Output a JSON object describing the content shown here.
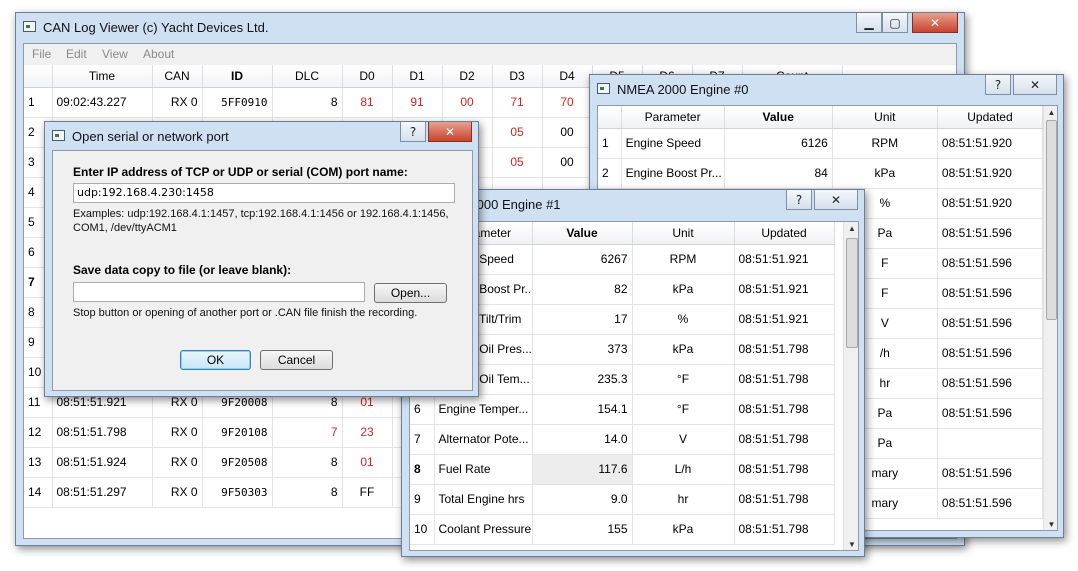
{
  "main": {
    "title": "CAN Log Viewer (c) Yacht Devices Ltd.",
    "menu": [
      "File",
      "Edit",
      "View",
      "About"
    ],
    "columns": [
      "Time",
      "CAN",
      "ID",
      "DLC",
      "D0",
      "D1",
      "D2",
      "D3",
      "D4",
      "D5",
      "D6",
      "D7",
      "Count"
    ],
    "rows": [
      {
        "n": "1",
        "time": "09:02:43.227",
        "can": "RX 0",
        "id": "5FF0910",
        "dlc": "8",
        "d": [
          "81",
          "91",
          "00",
          "71",
          "70"
        ],
        "red": [
          true,
          true,
          true,
          true,
          true
        ]
      },
      {
        "n": "2",
        "time": "",
        "can": "",
        "id": "",
        "dlc": "",
        "d": [
          "",
          "",
          "",
          "05",
          "00"
        ],
        "red": [
          false,
          false,
          false,
          true,
          false
        ]
      },
      {
        "n": "3",
        "time": "",
        "can": "",
        "id": "",
        "dlc": "",
        "d": [
          "",
          "",
          "",
          "05",
          "00"
        ],
        "red": [
          false,
          false,
          false,
          true,
          false
        ]
      },
      {
        "n": "4",
        "time": "",
        "can": "",
        "id": "",
        "dlc": "",
        "d": [
          "",
          "",
          "",
          "",
          ""
        ],
        "red": [
          false,
          false,
          false,
          false,
          false
        ]
      },
      {
        "n": "5",
        "time": "",
        "can": "",
        "id": "",
        "dlc": "",
        "d": [
          "",
          "",
          "",
          "",
          ""
        ],
        "red": [
          false,
          false,
          false,
          false,
          false
        ]
      },
      {
        "n": "6",
        "time": "",
        "can": "",
        "id": "",
        "dlc": "",
        "d": [
          "",
          "",
          "",
          "",
          ""
        ],
        "red": [
          false,
          false,
          false,
          false,
          false
        ]
      },
      {
        "n": "7",
        "time": "",
        "can": "",
        "id": "",
        "dlc": "",
        "d": [
          "",
          "",
          "",
          "",
          ""
        ],
        "red": [
          false,
          false,
          false,
          false,
          false
        ]
      },
      {
        "n": "8",
        "time": "",
        "can": "",
        "id": "",
        "dlc": "",
        "d": [
          "",
          "",
          "",
          "",
          ""
        ],
        "red": [
          false,
          false,
          false,
          false,
          false
        ]
      },
      {
        "n": "9",
        "time": "",
        "can": "",
        "id": "",
        "dlc": "",
        "d": [
          "",
          "",
          "",
          "",
          ""
        ],
        "red": [
          false,
          false,
          false,
          false,
          false
        ]
      },
      {
        "n": "10",
        "time": "",
        "can": "",
        "id": "",
        "dlc": "",
        "d": [
          "",
          "",
          "",
          "",
          ""
        ],
        "red": [
          false,
          false,
          false,
          false,
          false
        ]
      },
      {
        "n": "11",
        "time": "08:51:51.921",
        "can": "RX 0",
        "id": "9F20008",
        "dlc": "8",
        "d": [
          "01",
          "",
          "",
          "",
          ""
        ],
        "red": [
          true,
          false,
          false,
          false,
          false
        ]
      },
      {
        "n": "12",
        "time": "08:51:51.798",
        "can": "RX 0",
        "id": "9F20108",
        "dlc": "7",
        "d": [
          "23",
          "",
          "",
          "",
          ""
        ],
        "red": [
          true,
          false,
          false,
          false,
          false
        ],
        "dlcRed": true
      },
      {
        "n": "13",
        "time": "08:51:51.924",
        "can": "RX 0",
        "id": "9F20508",
        "dlc": "8",
        "d": [
          "01",
          "",
          "",
          "",
          ""
        ],
        "red": [
          true,
          false,
          false,
          false,
          false
        ]
      },
      {
        "n": "14",
        "time": "08:51:51.297",
        "can": "RX 0",
        "id": "9F50303",
        "dlc": "8",
        "d": [
          "FF",
          "",
          "",
          "",
          ""
        ],
        "red": [
          false,
          false,
          false,
          false,
          false
        ]
      }
    ]
  },
  "engine0": {
    "title": "NMEA 2000 Engine #0",
    "columns": [
      "Parameter",
      "Value",
      "Unit",
      "Updated"
    ],
    "rows": [
      {
        "n": "1",
        "param": "Engine Speed",
        "value": "6126",
        "unit": "RPM",
        "updated": "08:51:51.920"
      },
      {
        "n": "2",
        "param": "Engine Boost Pr...",
        "value": "84",
        "unit": "kPa",
        "updated": "08:51:51.920"
      },
      {
        "n": "3",
        "param": "",
        "value": "",
        "unit": "%",
        "updated": "08:51:51.920"
      },
      {
        "n": "4",
        "param": "",
        "value": "",
        "unit": "Pa",
        "updated": "08:51:51.596"
      },
      {
        "n": "5",
        "param": "",
        "value": "",
        "unit": "F",
        "updated": "08:51:51.596"
      },
      {
        "n": "6",
        "param": "",
        "value": "",
        "unit": "F",
        "updated": "08:51:51.596"
      },
      {
        "n": "7",
        "param": "",
        "value": "",
        "unit": "V",
        "updated": "08:51:51.596"
      },
      {
        "n": "8",
        "param": "",
        "value": "",
        "unit": "/h",
        "updated": "08:51:51.596"
      },
      {
        "n": "9",
        "param": "",
        "value": "",
        "unit": "hr",
        "updated": "08:51:51.596"
      },
      {
        "n": "10",
        "param": "",
        "value": "",
        "unit": "Pa",
        "updated": "08:51:51.596"
      },
      {
        "n": "11",
        "param": "",
        "value": "",
        "unit": "Pa",
        "updated": ""
      },
      {
        "n": "12",
        "param": "",
        "value": "",
        "unit": "mary",
        "updated": "08:51:51.596"
      },
      {
        "n": "13",
        "param": "",
        "value": "",
        "unit": "mary",
        "updated": "08:51:51.596"
      }
    ]
  },
  "engine1": {
    "title": "NMEA 2000 Engine #1",
    "columns": [
      "Parameter",
      "Value",
      "Unit",
      "Updated"
    ],
    "rows": [
      {
        "n": "1",
        "param": "Engine Speed",
        "value": "6267",
        "unit": "RPM",
        "updated": "08:51:51.921"
      },
      {
        "n": "2",
        "param": "Engine Boost Pr...",
        "value": "82",
        "unit": "kPa",
        "updated": "08:51:51.921"
      },
      {
        "n": "3",
        "param": "Engine Tilt/Trim",
        "value": "17",
        "unit": "%",
        "updated": "08:51:51.921"
      },
      {
        "n": "4",
        "param": "Engine Oil Pres...",
        "value": "373",
        "unit": "kPa",
        "updated": "08:51:51.798"
      },
      {
        "n": "5",
        "param": "Engine Oil Tem...",
        "value": "235.3",
        "unit": "°F",
        "updated": "08:51:51.798"
      },
      {
        "n": "6",
        "param": "Engine Temper...",
        "value": "154.1",
        "unit": "°F",
        "updated": "08:51:51.798"
      },
      {
        "n": "7",
        "param": "Alternator Pote...",
        "value": "14.0",
        "unit": "V",
        "updated": "08:51:51.798"
      },
      {
        "n": "8",
        "param": "Fuel Rate",
        "value": "117.6",
        "unit": "L/h",
        "updated": "08:51:51.798",
        "bold": true,
        "sel": true
      },
      {
        "n": "9",
        "param": "Total Engine hrs",
        "value": "9.0",
        "unit": "hr",
        "updated": "08:51:51.798"
      },
      {
        "n": "10",
        "param": "Coolant Pressure",
        "value": "155",
        "unit": "kPa",
        "updated": "08:51:51.798"
      }
    ]
  },
  "dialog": {
    "title": "Open serial or network port",
    "label1": "Enter IP address of TCP or UDP or serial (COM) port name:",
    "address": "udp:192.168.4.230:1458",
    "examples": "Examples: udp:192.168.4.1:1457, tcp:192.168.4.1:1456 or 192.168.4.1:1456, COM1, /dev/ttyACM1",
    "label2": "Save data copy to file (or leave blank):",
    "file": "",
    "open_btn": "Open...",
    "note": "Stop button or opening of another port or .CAN file finish the recording.",
    "ok": "OK",
    "cancel": "Cancel"
  },
  "icons": {
    "window": "app-window-icon",
    "help": "help-icon",
    "close": "close-icon",
    "minimize": "minimize-icon",
    "maximize": "maximize-icon"
  },
  "colors": {
    "frame": "#cfe0f2",
    "red_value": "#d0261c",
    "close_button": "#c9442d"
  }
}
